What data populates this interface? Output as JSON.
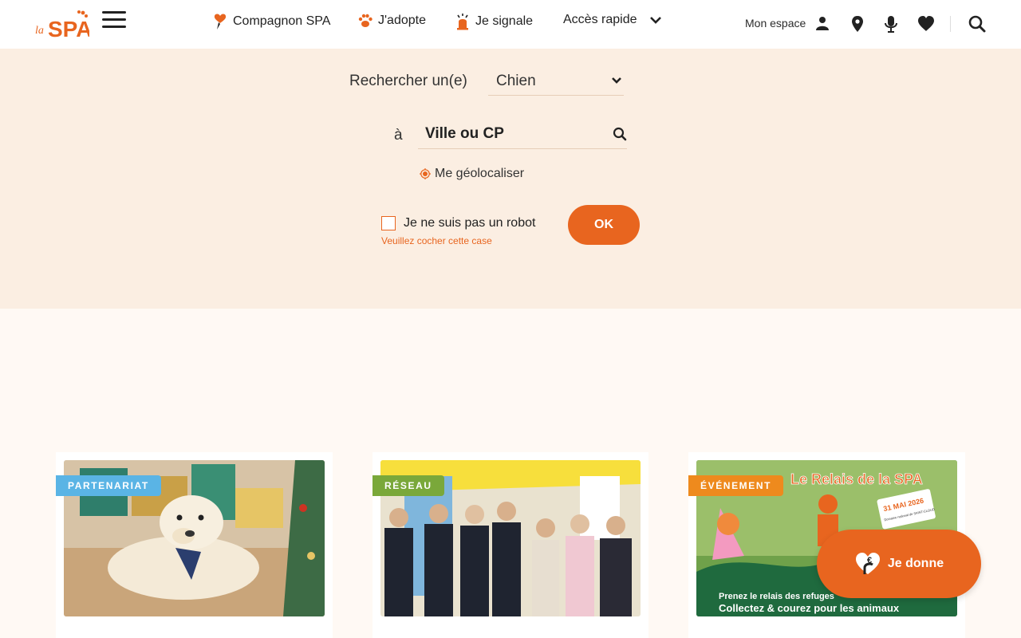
{
  "header": {
    "logo_text": "laSPA",
    "nav": [
      {
        "label": "Compagnon SPA",
        "icon": "heart-pin-icon"
      },
      {
        "label": "J'adopte",
        "icon": "paw-icon"
      },
      {
        "label": "Je signale",
        "icon": "siren-icon"
      },
      {
        "label": "Accès rapide",
        "icon": "chevron-down-icon"
      }
    ],
    "account_label": "Mon espace",
    "icons": [
      "user-icon",
      "location-pin-icon",
      "microphone-icon",
      "heart-icon",
      "search-icon"
    ]
  },
  "search": {
    "label": "Rechercher un(e)",
    "species_value": "Chien",
    "location_label": "à",
    "location_placeholder": "Ville ou CP",
    "geoloc_label": "Me géolocaliser",
    "captcha_label": "Je ne suis pas un robot",
    "captcha_error": "Veuillez cocher cette case",
    "submit_label": "OK"
  },
  "cards": [
    {
      "tag": "PARTENARIAT",
      "tag_color": "#5ab4e5",
      "image": "golden-retriever-with-christmas-gifts"
    },
    {
      "tag": "RÉSEAU",
      "tag_color": "#7aa83a",
      "image": "group-photo-at-event"
    },
    {
      "tag": "ÉVÉNEMENT",
      "tag_color": "#ee8a1d",
      "image": "le-relais-de-la-spa-poster",
      "image_text": {
        "title": "Le Relais de la SPA",
        "date": "31 MAI 2026",
        "place": "Domaine national de SAINT-CLOUD",
        "line1": "Prenez le relais des refuges",
        "line2": "Collectez & courez pour les animaux"
      }
    }
  ],
  "donate": {
    "label": "Je donne"
  },
  "colors": {
    "brand_orange": "#e8651f",
    "band": "#fbeee2",
    "page": "#fff9f4"
  }
}
